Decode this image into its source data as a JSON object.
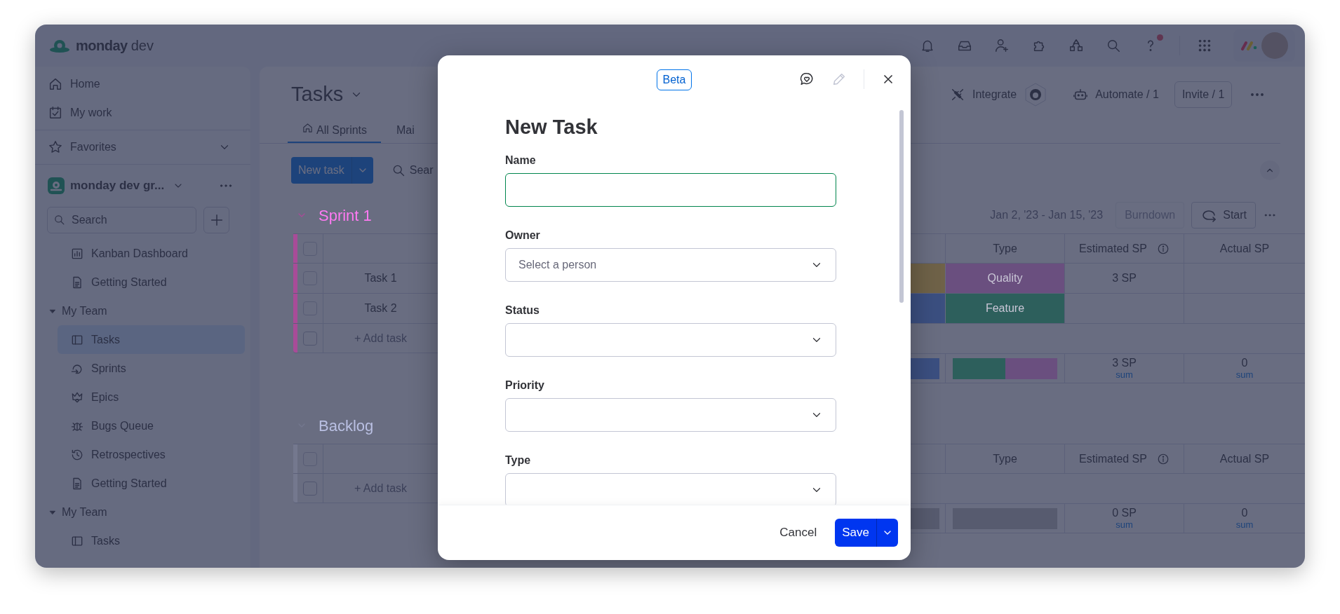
{
  "app": {
    "brand": "monday",
    "product": "dev"
  },
  "sidebar": {
    "nav": [
      {
        "label": "Home"
      },
      {
        "label": "My work"
      }
    ],
    "favorites": {
      "label": "Favorites"
    },
    "workspace": {
      "name": "monday dev gr..."
    },
    "search": {
      "placeholder": "Search"
    },
    "tree": [
      {
        "label": "Kanban Dashboard",
        "kind": "dashboard",
        "selected": false
      },
      {
        "label": "Getting Started",
        "kind": "doc",
        "selected": false
      },
      {
        "label": "My Team",
        "kind": "folder",
        "expanded": true,
        "children": [
          {
            "label": "Tasks",
            "kind": "board",
            "selected": true
          },
          {
            "label": "Sprints",
            "kind": "sprint",
            "selected": false
          },
          {
            "label": "Epics",
            "kind": "epic",
            "selected": false
          },
          {
            "label": "Bugs Queue",
            "kind": "bug",
            "selected": false
          },
          {
            "label": "Retrospectives",
            "kind": "retro",
            "selected": false
          },
          {
            "label": "Getting Started",
            "kind": "doc",
            "selected": false
          }
        ]
      },
      {
        "label": "My Team",
        "kind": "folder",
        "expanded": true,
        "children": [
          {
            "label": "Tasks",
            "kind": "board",
            "selected": false
          }
        ]
      }
    ]
  },
  "board": {
    "title": "Tasks",
    "actions": [
      {
        "label": "Integrate",
        "kind": "integrate"
      },
      {
        "label": "Automate / 1",
        "kind": "automate"
      }
    ],
    "invite": "Invite / 1",
    "tabs": [
      {
        "label": "All Sprints",
        "selected": true
      },
      {
        "label": "Mai",
        "selected": false
      }
    ],
    "new_button": "New task",
    "search_button": "Sear",
    "groups": [
      {
        "title": "Sprint 1",
        "color": "#a84c98",
        "checked": false,
        "dates": "Jan 2, '23 - Jan 15, '23",
        "burndown": "Burndown",
        "start": "Start",
        "columns": [
          "Type",
          "Estimated SP",
          "Actual SP"
        ],
        "rows": [
          {
            "name": "Task 1",
            "checked": false,
            "column_3": {
              "color": "#6f6248"
            },
            "type": {
              "label": "Quality",
              "color": "#6a4f7f"
            },
            "estimated": "3 SP"
          },
          {
            "name": "Task 2",
            "checked": false,
            "column_3": {
              "color": "#3b4f80"
            },
            "type": {
              "label": "Feature",
              "color": "#2d5f5c"
            }
          }
        ],
        "add_row": {
          "label": "+ Add task",
          "checked": false
        },
        "summary": {
          "column_3_segments": [
            {
              "color": "#3b4f80"
            }
          ],
          "type_segments": [
            {
              "color": "#2d5f5c"
            },
            {
              "color": "#6a4f7f"
            }
          ],
          "estimated": "3 SP",
          "estimated_caption": "sum",
          "actual": "0",
          "actual_caption": "sum"
        }
      },
      {
        "title": "Backlog",
        "color": "#74788e",
        "checked": false,
        "columns": [
          "Type",
          "Estimated SP",
          "Actual SP"
        ],
        "add_row": {
          "label": "+ Add task",
          "checked": false
        },
        "summary": {
          "estimated": "0 SP",
          "estimated_caption": "sum",
          "actual": "0",
          "actual_caption": "sum"
        }
      }
    ]
  },
  "dialog": {
    "badge": "Beta",
    "title": "New Task",
    "fields": [
      {
        "label": "Name",
        "kind": "text",
        "focused": true
      },
      {
        "label": "Owner",
        "kind": "select",
        "placeholder": "Select a person",
        "focused": false
      },
      {
        "label": "Status",
        "kind": "select",
        "focused": false
      },
      {
        "label": "Priority",
        "kind": "select",
        "focused": false
      },
      {
        "label": "Type",
        "kind": "select",
        "focused": false
      }
    ],
    "cancel": "Cancel",
    "save": "Save"
  }
}
